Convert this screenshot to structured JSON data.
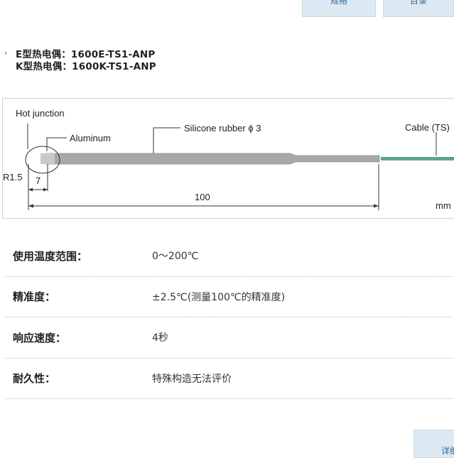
{
  "top_tabs": [
    {
      "label": "规格"
    },
    {
      "label": "目录"
    }
  ],
  "models": [
    {
      "label": "E型热电偶：1600E-TS1-ANP"
    },
    {
      "label": "K型热电偶：1600K-TS1-ANP"
    }
  ],
  "diagram": {
    "hot_junction": "Hot junction",
    "aluminum": "Aluminum",
    "silicone": "Silicone rubber ϕ 3",
    "cable": "Cable (TS)",
    "r_label": "R1.5",
    "dim_7": "7",
    "dim_100": "100",
    "unit": "mm",
    "colors": {
      "probe": "#a8a8ab",
      "probe_edge": "#8c8c90",
      "cable": "#5fa395"
    }
  },
  "specs": [
    {
      "label": "使用温度范围：",
      "value": "0～200℃"
    },
    {
      "label": "精准度：",
      "value": "±2.5℃(测量100℃的精准度)"
    },
    {
      "label": "响应速度：",
      "value": "4秒"
    },
    {
      "label": "耐久性：",
      "value": "特殊构造无法评价"
    }
  ],
  "detail_button": {
    "label": "详细"
  }
}
